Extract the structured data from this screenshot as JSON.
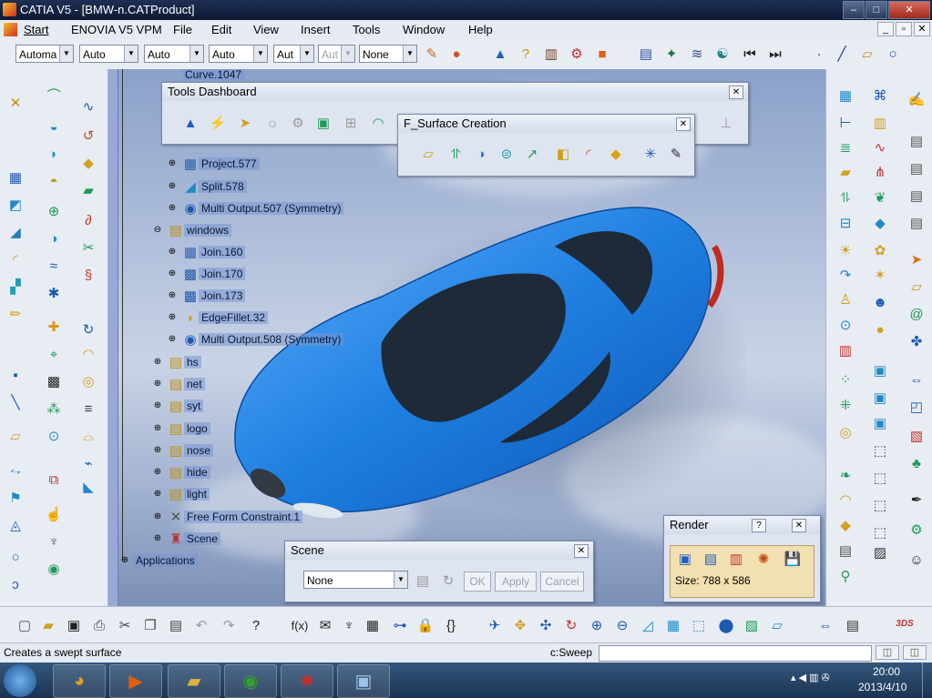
{
  "window": {
    "title": "CATIA V5 - [BMW-n.CATProduct]",
    "controls": {
      "minimize": "–",
      "maximize": "□",
      "close": "✕"
    },
    "doc_controls": {
      "minimize": "_",
      "restore": "▫",
      "close": "✕"
    }
  },
  "menubar": {
    "items": [
      "Start",
      "ENOVIA V5 VPM",
      "File",
      "Edit",
      "View",
      "Insert",
      "Tools",
      "Window",
      "Help"
    ]
  },
  "toolbar": {
    "combos": [
      {
        "value": "Automa",
        "disabled": false
      },
      {
        "value": "Auto",
        "disabled": false
      },
      {
        "value": "Auto",
        "disabled": false
      },
      {
        "value": "Auto",
        "disabled": false
      },
      {
        "value": "Aut",
        "disabled": false
      },
      {
        "value": "Aut",
        "disabled": true
      },
      {
        "value": "None",
        "disabled": false
      }
    ]
  },
  "tree": {
    "top_item": "Curve.1047",
    "items": [
      {
        "label": "Project.577"
      },
      {
        "label": "Split.578"
      },
      {
        "label": "Multi Output.507 (Symmetry)"
      },
      {
        "label": "windows"
      },
      {
        "label": "Join.160"
      },
      {
        "label": "Join.170"
      },
      {
        "label": "Join.173"
      },
      {
        "label": "EdgeFillet.32"
      },
      {
        "label": "Multi Output.508 (Symmetry)"
      },
      {
        "label": "hs"
      },
      {
        "label": "net"
      },
      {
        "label": "syt"
      },
      {
        "label": "logo"
      },
      {
        "label": "nose"
      },
      {
        "label": "hide"
      },
      {
        "label": "light"
      },
      {
        "label": "Free Form Constraint.1"
      },
      {
        "label": "Scene"
      },
      {
        "label": "Applications"
      }
    ]
  },
  "tools_dashboard": {
    "title": "Tools Dashboard"
  },
  "surface_creation": {
    "title": "F_Surface Creation"
  },
  "scene_panel": {
    "title": "Scene",
    "value": "None",
    "ok": "OK",
    "apply": "Apply",
    "cancel": "Cancel"
  },
  "render_panel": {
    "title": "Render",
    "help": "?",
    "size": "Size: 788 x 586"
  },
  "status": {
    "message": "Creates a swept surface",
    "command": "c:Sweep"
  },
  "taskbar": {
    "time": "20:00",
    "date": "2013/4/10"
  },
  "colors": {
    "car": "#1f7fe0",
    "tree_highlight": "#7a96d2"
  }
}
